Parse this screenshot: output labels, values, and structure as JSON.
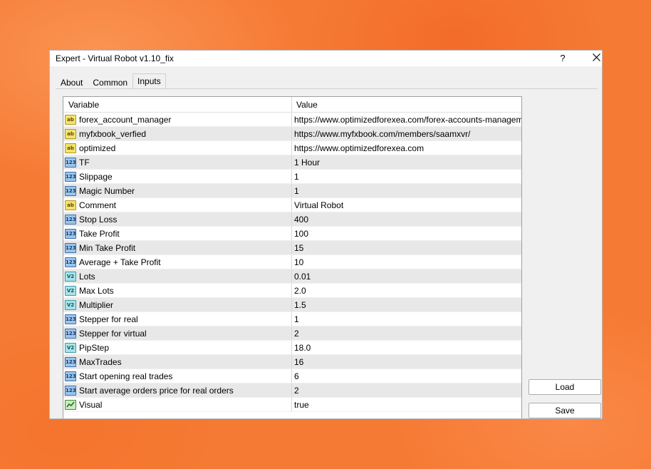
{
  "window": {
    "title": "Expert - Virtual Robot v1.10_fix",
    "help_label": "?"
  },
  "tabs": [
    {
      "label": "About",
      "active": false
    },
    {
      "label": "Common",
      "active": false
    },
    {
      "label": "Inputs",
      "active": true
    }
  ],
  "grid": {
    "columns": [
      "Variable",
      "Value"
    ],
    "rows": [
      {
        "type": "str",
        "type_label": "ab",
        "variable": "forex_account_manager",
        "value": "https://www.optimizedforexea.com/forex-accounts-management/"
      },
      {
        "type": "str",
        "type_label": "ab",
        "variable": "myfxbook_verfied",
        "value": "https://www.myfxbook.com/members/saamxvr/"
      },
      {
        "type": "str",
        "type_label": "ab",
        "variable": "optimized",
        "value": "https://www.optimizedforexea.com"
      },
      {
        "type": "int",
        "type_label": "123",
        "variable": "TF",
        "value": "1 Hour"
      },
      {
        "type": "int",
        "type_label": "123",
        "variable": "Slippage",
        "value": "1"
      },
      {
        "type": "int",
        "type_label": "123",
        "variable": "Magic Number",
        "value": "1"
      },
      {
        "type": "str",
        "type_label": "ab",
        "variable": "Comment",
        "value": "Virtual Robot"
      },
      {
        "type": "int",
        "type_label": "123",
        "variable": "Stop Loss",
        "value": "400"
      },
      {
        "type": "int",
        "type_label": "123",
        "variable": "Take Profit",
        "value": "100"
      },
      {
        "type": "int",
        "type_label": "123",
        "variable": "Min Take Profit",
        "value": "15"
      },
      {
        "type": "int",
        "type_label": "123",
        "variable": "Average + Take Profit",
        "value": "10"
      },
      {
        "type": "dbl",
        "type_label": "V2",
        "variable": "Lots",
        "value": "0.01"
      },
      {
        "type": "dbl",
        "type_label": "V2",
        "variable": "Max Lots",
        "value": "2.0"
      },
      {
        "type": "dbl",
        "type_label": "V2",
        "variable": "Multiplier",
        "value": "1.5"
      },
      {
        "type": "int",
        "type_label": "123",
        "variable": "Stepper for real",
        "value": "1"
      },
      {
        "type": "int",
        "type_label": "123",
        "variable": "Stepper for virtual",
        "value": "2"
      },
      {
        "type": "dbl",
        "type_label": "V2",
        "variable": "PipStep",
        "value": "18.0"
      },
      {
        "type": "int",
        "type_label": "123",
        "variable": "MaxTrades",
        "value": "16"
      },
      {
        "type": "int",
        "type_label": "123",
        "variable": "Start opening real trades",
        "value": "6"
      },
      {
        "type": "int",
        "type_label": "123",
        "variable": "Start average orders price for real orders",
        "value": "2"
      },
      {
        "type": "bool",
        "type_label": "",
        "variable": "Visual",
        "value": "true"
      }
    ]
  },
  "buttons": {
    "load": "Load",
    "save": "Save"
  },
  "icons": {
    "close": "close-icon",
    "string_type": "string-type-icon",
    "integer_type": "integer-type-icon",
    "double_type": "double-type-icon",
    "bool_type": "bool-type-icon"
  }
}
